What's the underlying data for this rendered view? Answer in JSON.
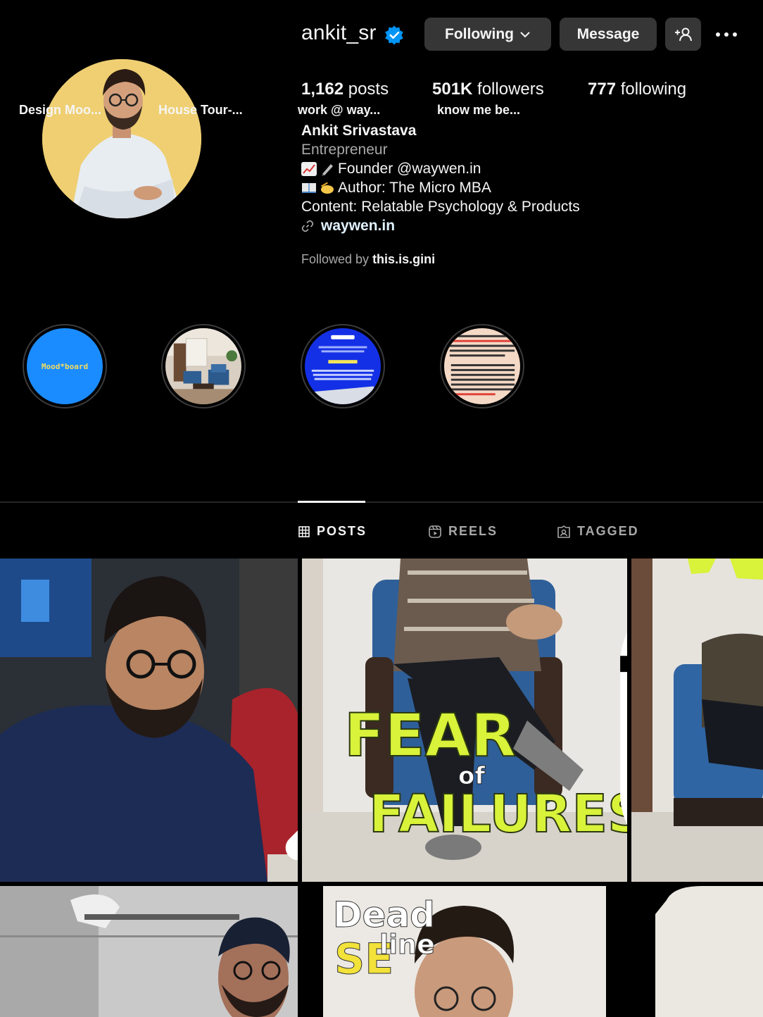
{
  "profile": {
    "username": "ankit_sr",
    "verified_icon": "verified-badge-icon",
    "buttons": {
      "following": "Following",
      "message": "Message"
    },
    "stats": {
      "posts_count": "1,162",
      "posts_label": " posts",
      "followers_count": "501K",
      "followers_label": " followers",
      "following_count": "777",
      "following_label": " following"
    },
    "bio": {
      "name": "Ankit Srivastava",
      "category": "Entrepreneur",
      "line1": "Founder @waywen.in",
      "line2": "Author: The Micro MBA",
      "line3": "Content: Relatable Psychology & Products",
      "link": "waywen.in"
    },
    "followed_by_prefix": "Followed by ",
    "followed_by_user": "this.is.gini"
  },
  "highlights": [
    {
      "label": "Design Moo...",
      "cover_text": "Mood*board"
    },
    {
      "label": "House Tour-..."
    },
    {
      "label": "work @ way..."
    },
    {
      "label": "know me be..."
    }
  ],
  "tabs": [
    {
      "label": "POSTS",
      "icon": "grid-icon",
      "active": true
    },
    {
      "label": "REELS",
      "icon": "reels-icon",
      "active": false
    },
    {
      "label": "TAGGED",
      "icon": "tagged-icon",
      "active": false
    }
  ],
  "posts": [
    {
      "type": "pinned",
      "badge": "pin-icon"
    },
    {
      "type": "reel",
      "badge": "reel-icon",
      "text_lines": [
        "FEAR",
        "of",
        "FAILURES"
      ]
    },
    {
      "type": "reel",
      "badge": "reel-icon"
    },
    {
      "type": "reel",
      "badge": "reel-icon"
    },
    {
      "type": "reel",
      "badge": "reel-icon",
      "text_lines": [
        "Dead",
        "SE",
        "line"
      ]
    },
    {
      "type": "reel"
    }
  ],
  "colors": {
    "background": "#000000",
    "button_bg": "#363636",
    "verified_blue": "#0095f6",
    "muted_text": "#a8a8a8",
    "accent_yellow": "#d9f23a"
  }
}
